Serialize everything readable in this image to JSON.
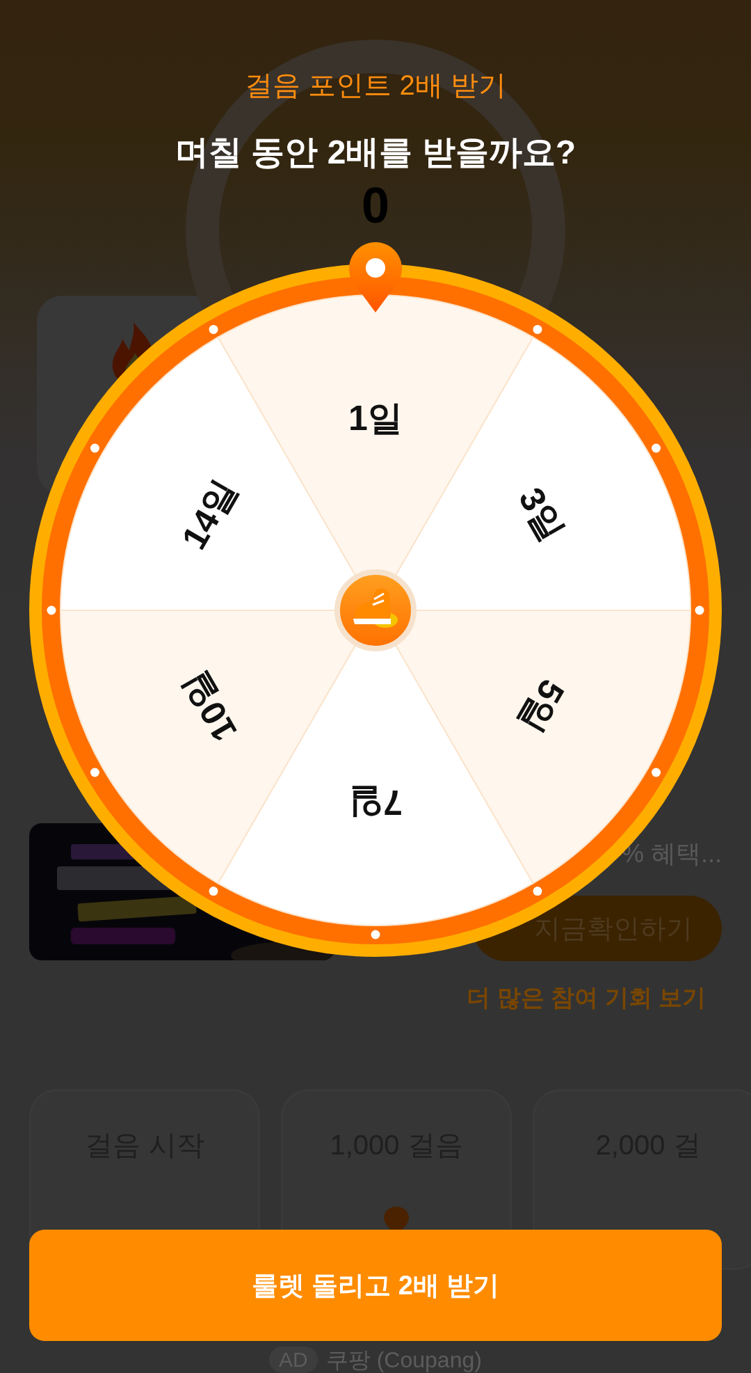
{
  "background": {
    "step_count": "0",
    "benefit_text": "% 혜택...",
    "check_button": "지금확인하기",
    "more_link": "더 많은 참여 기회 보기",
    "milestones": [
      {
        "label": "걸음 시작"
      },
      {
        "label": "1,000 걸음"
      },
      {
        "label": "2,000 걸"
      }
    ],
    "ad": {
      "badge": "AD",
      "advertiser": "쿠팡 (Coupang)"
    }
  },
  "dialog": {
    "subtitle": "걸음 포인트 2배 받기",
    "title": "며칠 동안 2배를 받을까요?",
    "roulette": {
      "segments": [
        {
          "label": "1일"
        },
        {
          "label": "3일"
        },
        {
          "label": "5일"
        },
        {
          "label": "7일"
        },
        {
          "label": "10일"
        },
        {
          "label": "14일"
        }
      ]
    },
    "button": "룰렛 돌리고 2배 받기"
  }
}
